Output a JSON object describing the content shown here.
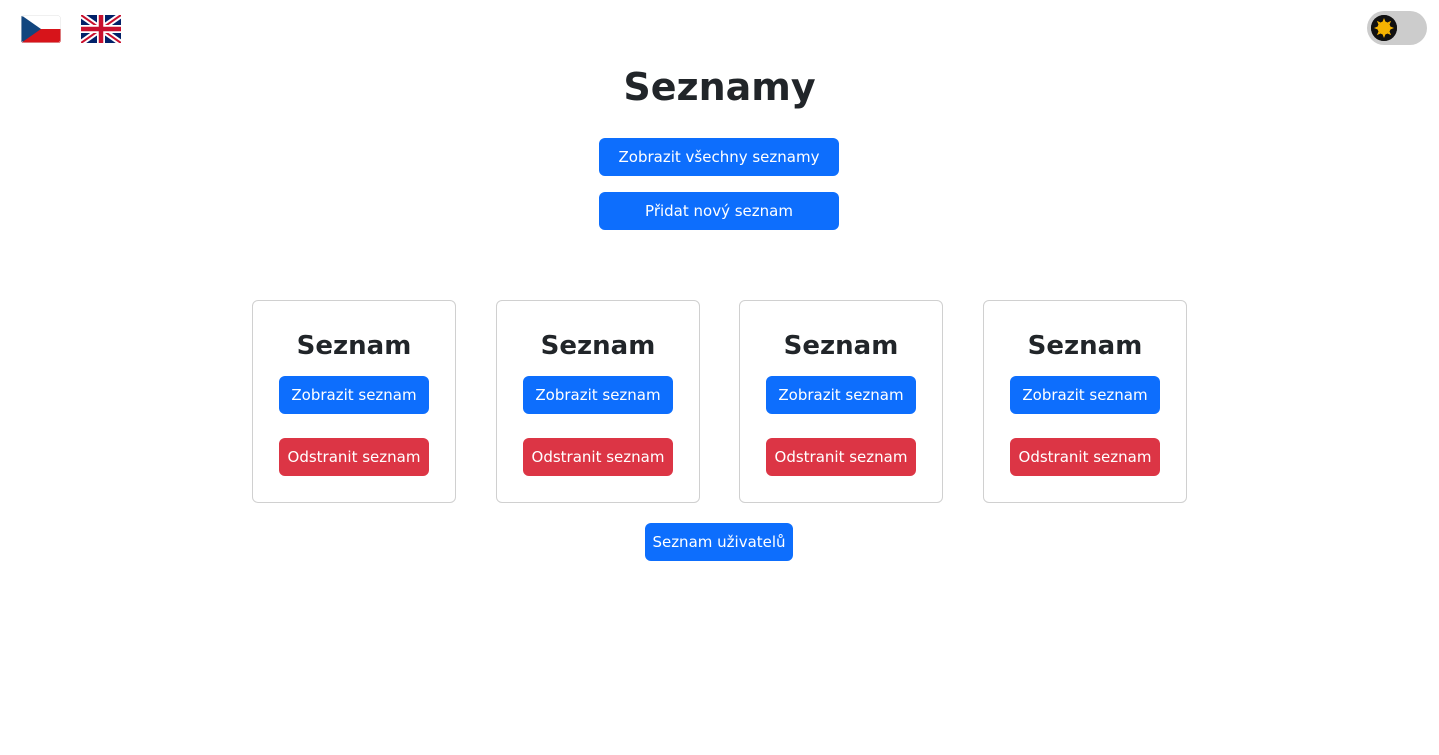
{
  "header": {
    "languages": [
      {
        "code": "cs",
        "icon": "czech-flag-icon"
      },
      {
        "code": "en",
        "icon": "uk-flag-icon"
      }
    ],
    "theme_toggle": {
      "icon": "sun-icon",
      "state": "light"
    }
  },
  "main": {
    "title": "Seznamy",
    "show_all_label": "Zobrazit všechny seznamy",
    "add_new_label": "Přidat nový seznam",
    "cards": [
      {
        "title": "Seznam",
        "view_label": "Zobrazit seznam",
        "delete_label": "Odstranit seznam"
      },
      {
        "title": "Seznam",
        "view_label": "Zobrazit seznam",
        "delete_label": "Odstranit seznam"
      },
      {
        "title": "Seznam",
        "view_label": "Zobrazit seznam",
        "delete_label": "Odstranit seznam"
      },
      {
        "title": "Seznam",
        "view_label": "Zobrazit seznam",
        "delete_label": "Odstranit seznam"
      }
    ],
    "users_label": "Seznam uživatelů"
  },
  "colors": {
    "primary": "#0d6efd",
    "danger": "#dc3545",
    "card_border": "#d0d0d0",
    "toggle_track": "#cccccc"
  }
}
